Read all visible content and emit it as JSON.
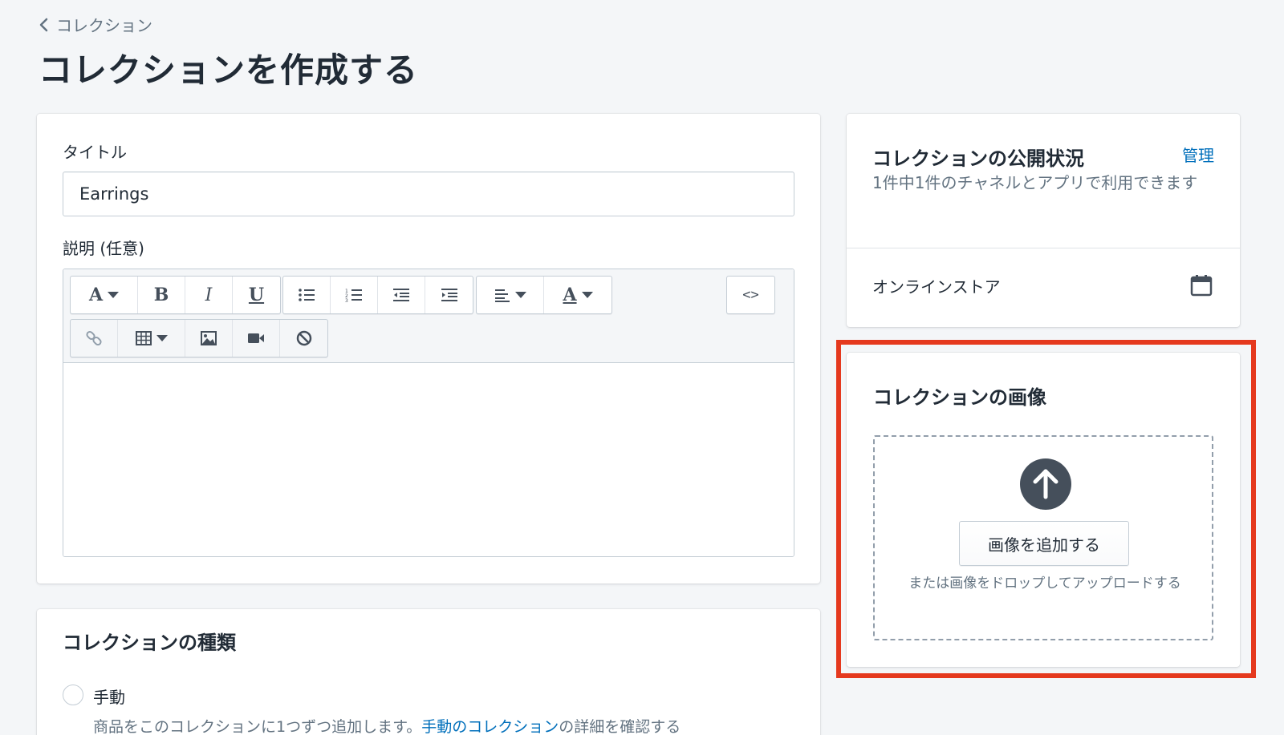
{
  "breadcrumb": {
    "label": "コレクション"
  },
  "page": {
    "title": "コレクションを作成する"
  },
  "form": {
    "title_label": "タイトル",
    "title_value": "Earrings",
    "description_label": "説明 (任意)",
    "html_button_label": "<>"
  },
  "toolbar_icons": {
    "row1": [
      "font-style-icon",
      "bold-icon",
      "italic-icon",
      "underline-icon",
      "bullet-list-icon",
      "numbered-list-icon",
      "outdent-icon",
      "indent-icon",
      "align-icon",
      "text-color-icon",
      "html-code-icon"
    ],
    "row2": [
      "link-icon",
      "table-icon",
      "image-icon",
      "video-icon",
      "clear-format-icon"
    ]
  },
  "collection_type": {
    "title": "コレクションの種類",
    "option_manual": "手動",
    "description_prefix": "商品をこのコレクションに1つずつ追加します。",
    "description_link": "手動のコレクション",
    "description_suffix": "の詳細を確認する"
  },
  "publishing": {
    "title": "コレクションの公開状況",
    "manage_link": "管理",
    "subtitle": "1件中1件のチャネルとアプリで利用できます",
    "channel": "オンラインストア"
  },
  "image": {
    "title": "コレクションの画像",
    "add_button": "画像を追加する",
    "drop_hint": "または画像をドロップしてアップロードする"
  },
  "colors": {
    "background": "#f4f6f8",
    "link": "#006fbb",
    "highlight": "#e5391e",
    "upload_icon_bg": "#454f5b"
  }
}
